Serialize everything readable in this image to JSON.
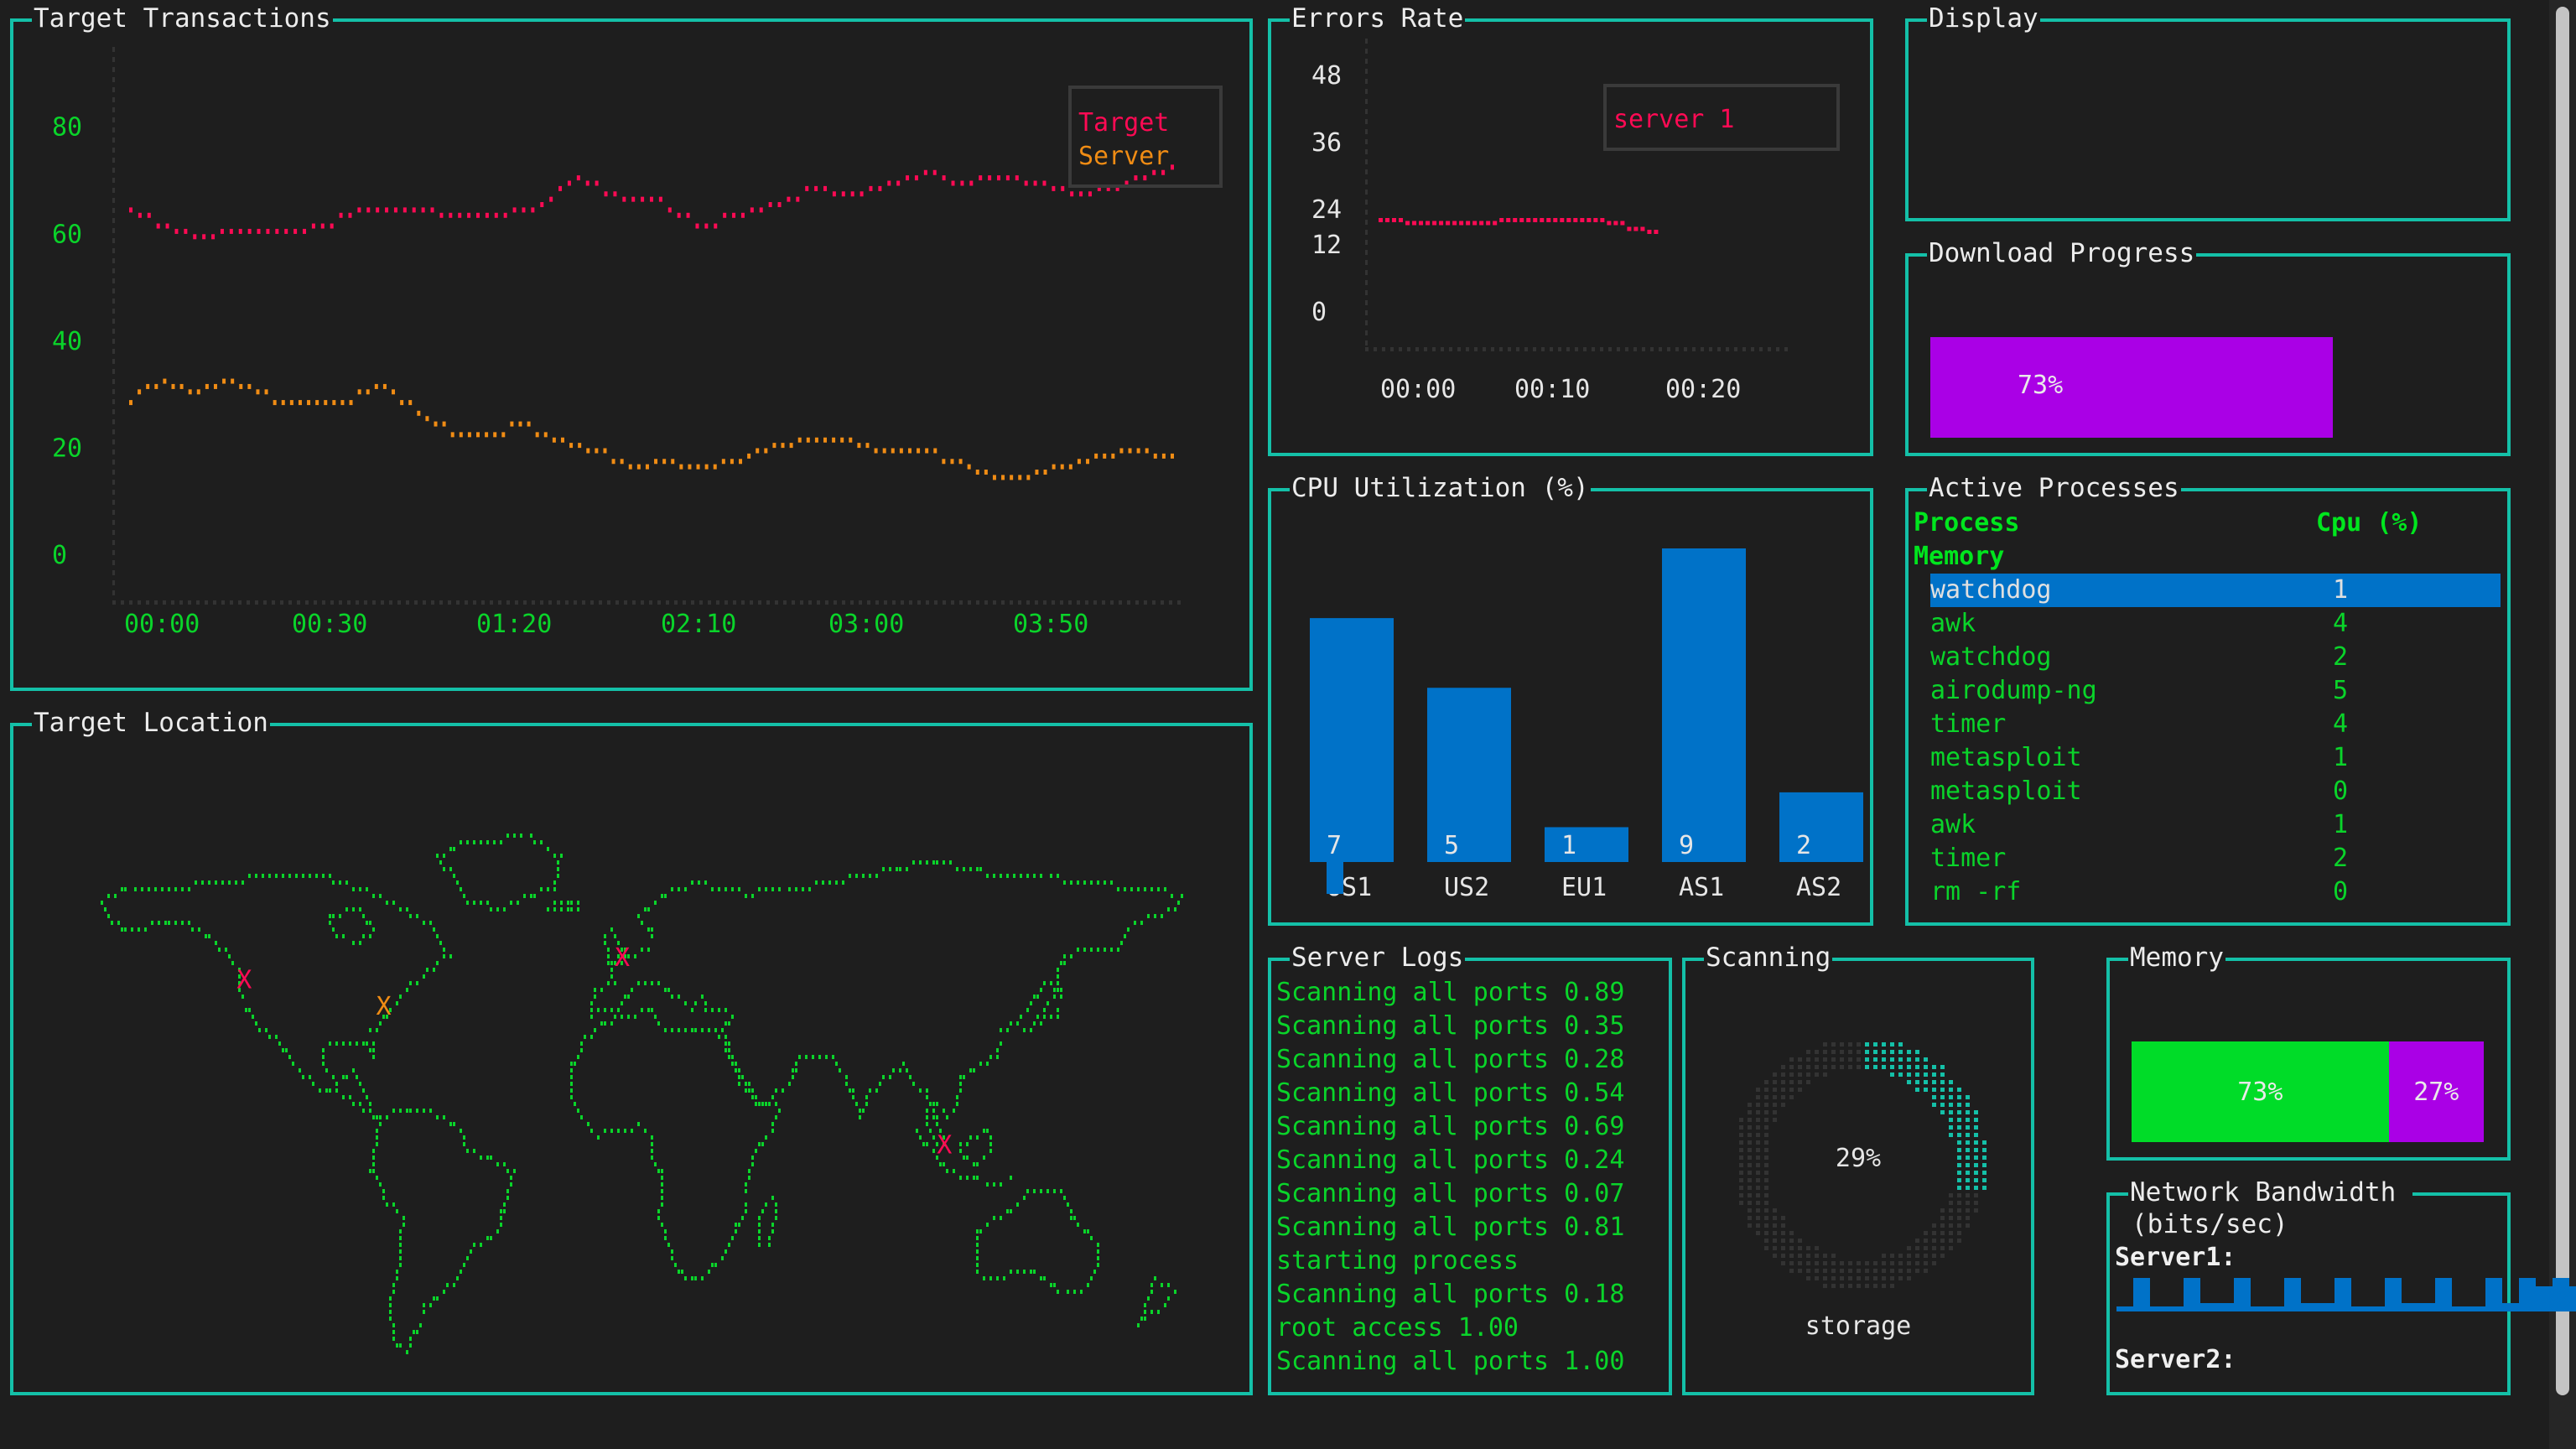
{
  "colors": {
    "border": "#14c0a8",
    "background": "#1e1e1e",
    "green": "#0ad42a",
    "bright_green": "#00e61e",
    "red": "#ff0a54",
    "orange": "#f08c14",
    "blue": "#0072c8",
    "purple": "#aa00e6",
    "teal": "#14c0a8",
    "dim": "#333333"
  },
  "panels": {
    "transactions": {
      "title": "Target Transactions"
    },
    "location": {
      "title": "Target Location"
    },
    "errors": {
      "title": "Errors Rate"
    },
    "display": {
      "title": "Display"
    },
    "download": {
      "title": "Download Progress",
      "percent": 73,
      "label": "73%"
    },
    "cpu": {
      "title": "CPU Utilization (%)"
    },
    "processes": {
      "title": "Active Processes"
    },
    "logs": {
      "title": "Server Logs"
    },
    "scanning": {
      "title": "Scanning",
      "percent": 29,
      "label": "29%",
      "caption": "storage"
    },
    "memory": {
      "title": "Memory",
      "used_percent": 73,
      "free_percent": 27,
      "used_label": "73%",
      "free_label": "27%"
    },
    "network": {
      "title": "Network Bandwidth",
      "subtitle": "(bits/sec)",
      "server1_label": "Server1:",
      "server2_label": "Server2:"
    }
  },
  "processes": {
    "headers": {
      "process": "Process",
      "cpu": "Cpu (%)",
      "memory": "Memory"
    },
    "selected_index": 0,
    "rows": [
      {
        "name": "watchdog",
        "cpu": "1"
      },
      {
        "name": "awk",
        "cpu": "4"
      },
      {
        "name": "watchdog",
        "cpu": "2"
      },
      {
        "name": "airodump-ng",
        "cpu": "5"
      },
      {
        "name": "timer",
        "cpu": "4"
      },
      {
        "name": "metasploit",
        "cpu": "1"
      },
      {
        "name": "metasploit",
        "cpu": "0"
      },
      {
        "name": "awk",
        "cpu": "1"
      },
      {
        "name": "timer",
        "cpu": "2"
      },
      {
        "name": "rm -rf",
        "cpu": "0"
      }
    ]
  },
  "logs": [
    "Scanning all ports 0.89",
    "Scanning all ports 0.35",
    "Scanning all ports 0.28",
    "Scanning all ports 0.54",
    "Scanning all ports 0.69",
    "Scanning all ports 0.24",
    "Scanning all ports 0.07",
    "Scanning all ports 0.81",
    "starting process",
    "Scanning all ports 0.18",
    "root access 1.00",
    "Scanning all ports 1.00"
  ],
  "map_markers": [
    {
      "label": "X",
      "color": "red",
      "lon": -122,
      "lat": 45
    },
    {
      "label": "X",
      "color": "orange",
      "lon": -77,
      "lat": 38
    },
    {
      "label": "X",
      "color": "red",
      "lon": 0,
      "lat": 51
    },
    {
      "label": "X",
      "color": "red",
      "lon": 104,
      "lat": 1
    }
  ],
  "network": {
    "server1": [
      1,
      8,
      1,
      1,
      8,
      2,
      2,
      8,
      1,
      1,
      8,
      2,
      2,
      8,
      1,
      1,
      8,
      2,
      2,
      8,
      1,
      1,
      8,
      2,
      8,
      6,
      8,
      6
    ]
  },
  "chart_data": [
    {
      "type": "line",
      "title": "Target Transactions",
      "ylim": [
        -5,
        95
      ],
      "yticks": [
        0,
        20,
        40,
        60,
        80
      ],
      "ytick_labels": [
        "0",
        "20",
        "40",
        "60",
        "80"
      ],
      "xtick_labels": [
        "00:00",
        "00:30",
        "01:20",
        "02:10",
        "03:00",
        "03:50"
      ],
      "legend": {
        "placement": "top-right",
        "entries": [
          "Target",
          "Server"
        ]
      },
      "series": [
        {
          "name": "Target",
          "color": "#ff0a54",
          "values": [
            65,
            64,
            64,
            62,
            62,
            61,
            61,
            60,
            60,
            60,
            61,
            61,
            61,
            61,
            61,
            61,
            61,
            61,
            61,
            61,
            62,
            62,
            62,
            64,
            64,
            65,
            65,
            65,
            65,
            65,
            65,
            65,
            65,
            65,
            64,
            64,
            64,
            64,
            64,
            64,
            64,
            64,
            65,
            65,
            65,
            66,
            67,
            69,
            70,
            71,
            70,
            70,
            68,
            68,
            67,
            67,
            67,
            67,
            67,
            65,
            64,
            64,
            62,
            62,
            62,
            64,
            64,
            64,
            65,
            65,
            66,
            66,
            67,
            67,
            69,
            69,
            69,
            68,
            68,
            68,
            68,
            69,
            69,
            70,
            70,
            71,
            71,
            72,
            72,
            71,
            70,
            70,
            70,
            71,
            71,
            71,
            71,
            71,
            70,
            70,
            70,
            69,
            69,
            68,
            68,
            68,
            69,
            69,
            69,
            70,
            71,
            71,
            72,
            72,
            73
          ]
        },
        {
          "name": "Server",
          "color": "#f08c14",
          "values": [
            29,
            31,
            32,
            32,
            33,
            32,
            32,
            31,
            31,
            32,
            32,
            33,
            33,
            32,
            32,
            31,
            31,
            29,
            29,
            29,
            29,
            29,
            29,
            29,
            29,
            29,
            29,
            31,
            31,
            32,
            32,
            31,
            29,
            29,
            27,
            26,
            25,
            25,
            23,
            23,
            23,
            23,
            23,
            23,
            23,
            25,
            25,
            25,
            23,
            23,
            22,
            22,
            21,
            21,
            20,
            20,
            20,
            18,
            18,
            17,
            17,
            17,
            18,
            18,
            18,
            17,
            17,
            17,
            17,
            17,
            18,
            18,
            18,
            19,
            20,
            20,
            21,
            21,
            21,
            22,
            22,
            22,
            22,
            22,
            22,
            22,
            21,
            21,
            20,
            20,
            20,
            20,
            20,
            20,
            20,
            20,
            18,
            18,
            18,
            17,
            16,
            16,
            15,
            15,
            15,
            15,
            15,
            16,
            16,
            17,
            17,
            17,
            18,
            18,
            19,
            19,
            19,
            20,
            20,
            20,
            20,
            19,
            19,
            19
          ]
        }
      ]
    },
    {
      "type": "line",
      "title": "Errors Rate",
      "ylim": [
        -4,
        60
      ],
      "yticks": [
        0,
        12,
        24,
        36,
        48
      ],
      "ytick_labels": [
        "0",
        "12",
        "24",
        "36",
        "48"
      ],
      "xtick_labels": [
        "00:00",
        "00:10",
        "00:20"
      ],
      "legend": {
        "placement": "top-right",
        "entries": [
          "server 1"
        ]
      },
      "series": [
        {
          "name": "server 1",
          "color": "#ff0a54",
          "values": [
            24,
            24,
            24,
            24,
            23,
            23,
            23,
            23,
            23,
            23,
            23,
            23,
            23,
            23,
            23,
            23,
            23,
            23,
            24,
            24,
            24,
            24,
            24,
            24,
            24,
            24,
            24,
            24,
            24,
            24,
            24,
            24,
            24,
            24,
            23,
            23,
            23,
            21,
            21,
            21,
            20,
            20
          ]
        }
      ]
    },
    {
      "type": "bar",
      "title": "CPU Utilization (%)",
      "categories": [
        "US1",
        "US2",
        "EU1",
        "AS1",
        "AS2"
      ],
      "values": [
        7,
        5,
        1,
        9,
        2
      ],
      "ylim": [
        0,
        10
      ]
    },
    {
      "type": "bar",
      "title": "Network Bandwidth (bits/sec) Server1",
      "values": [
        1,
        8,
        1,
        1,
        8,
        2,
        2,
        8,
        1,
        1,
        8,
        2,
        2,
        8,
        1,
        1,
        8,
        2,
        2,
        8,
        1,
        1,
        8,
        2,
        8,
        6,
        8,
        6
      ]
    }
  ]
}
